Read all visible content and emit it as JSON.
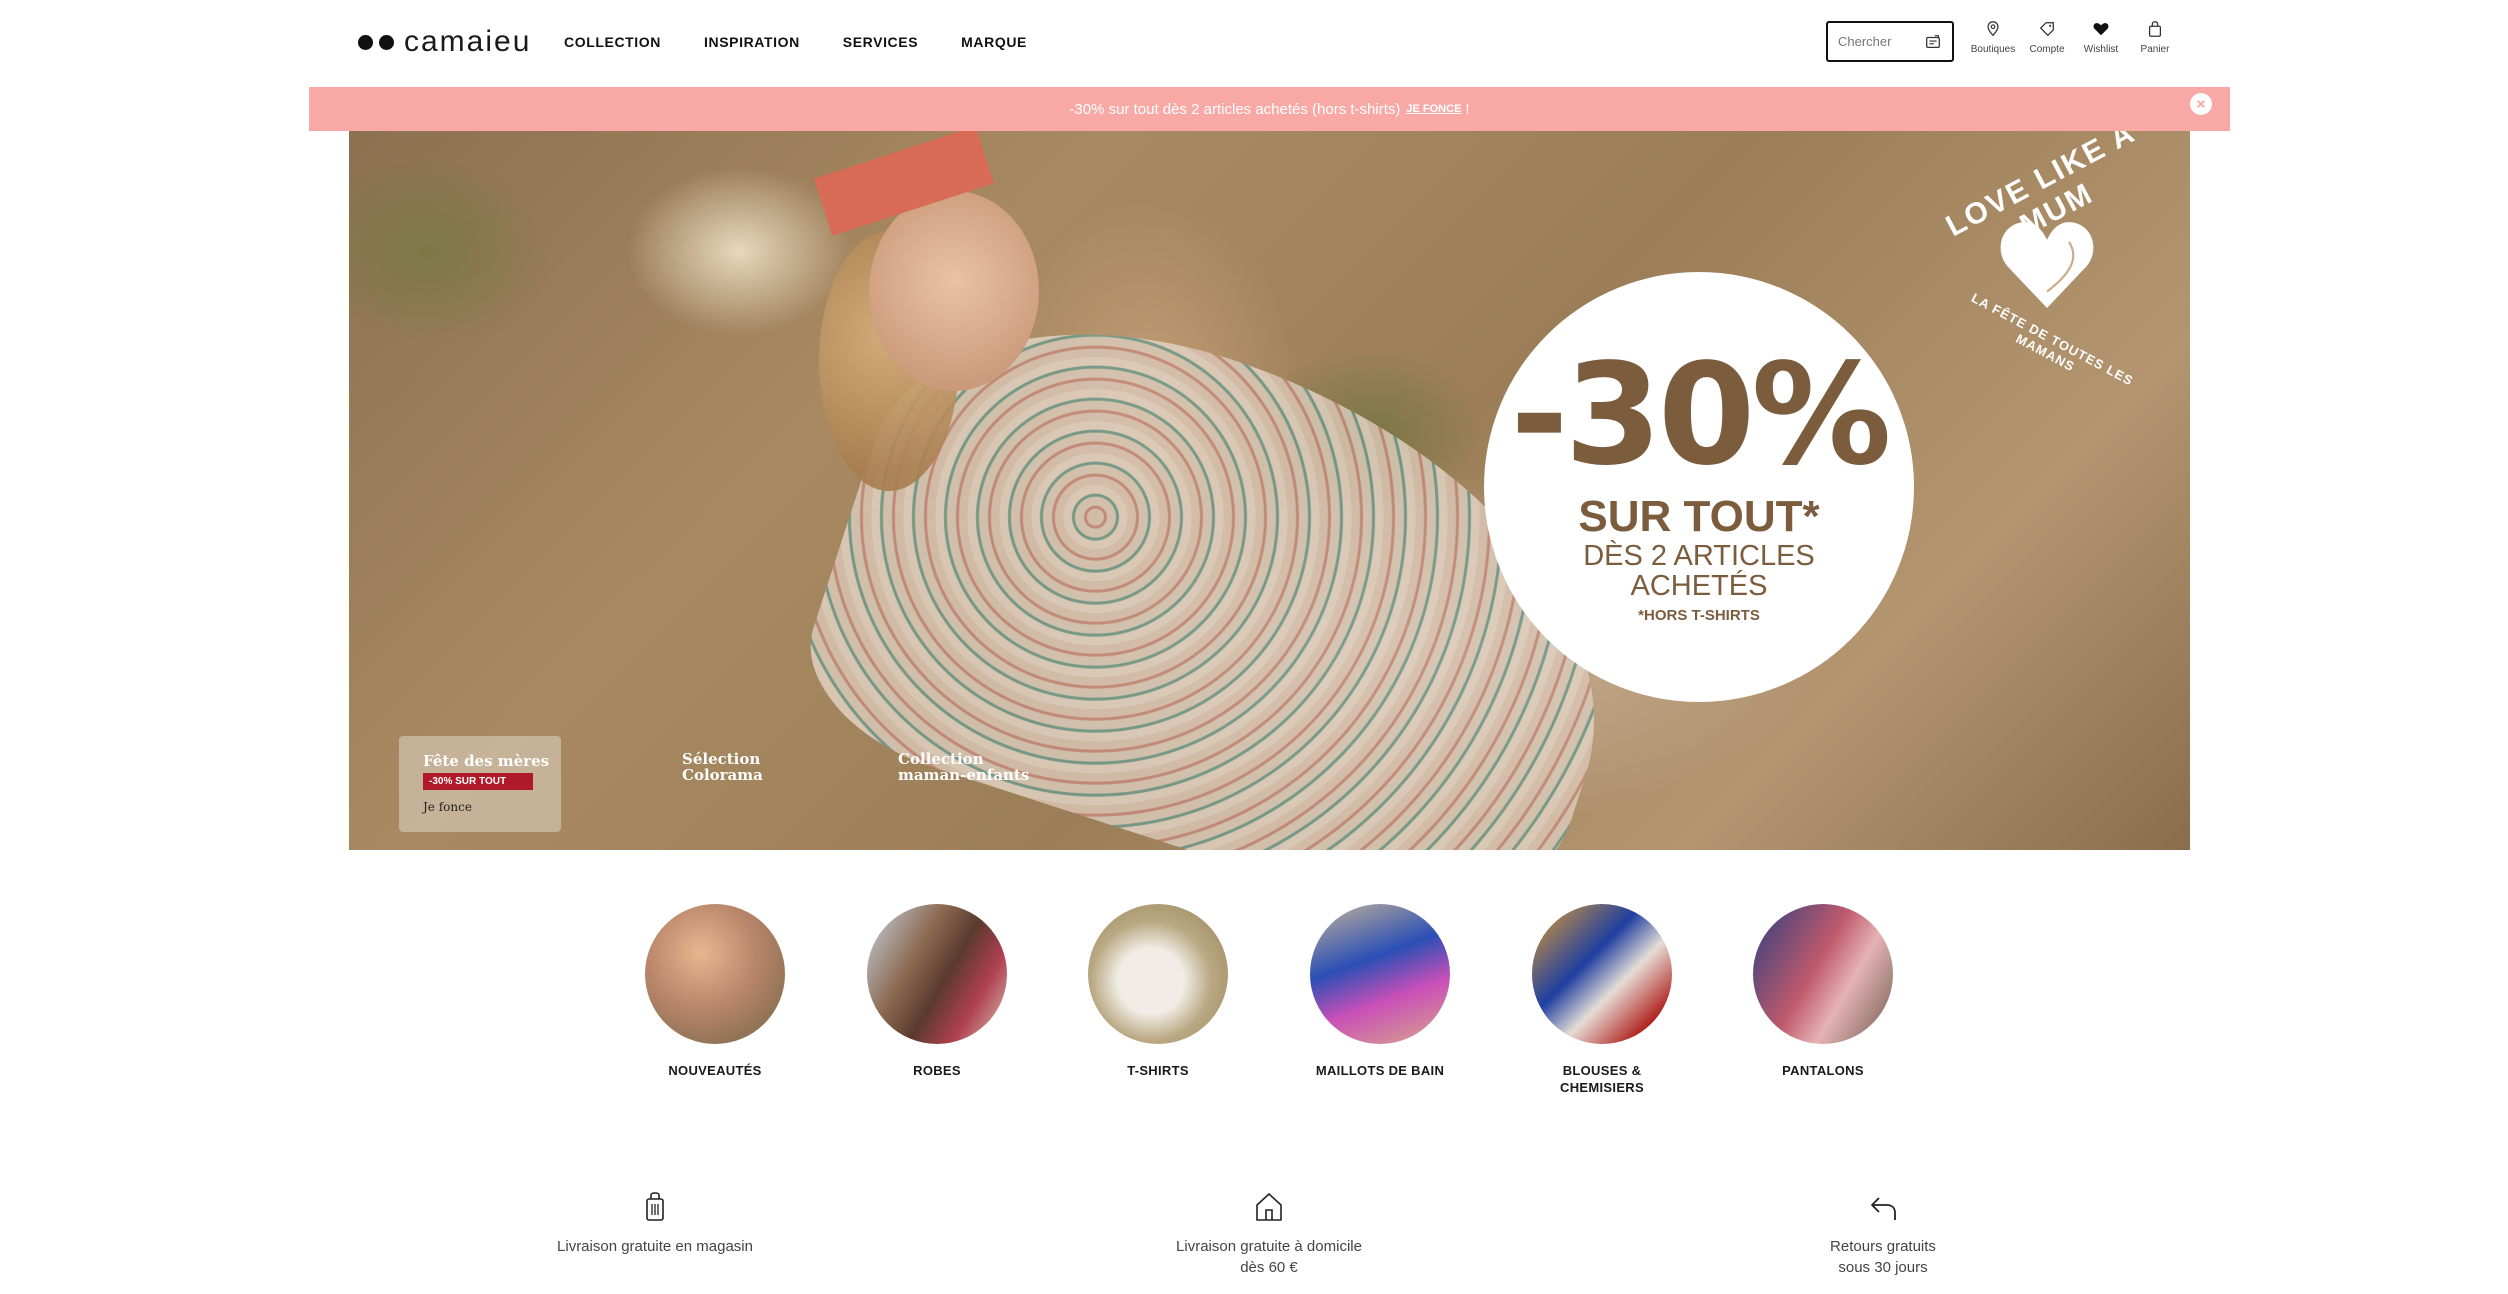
{
  "header": {
    "logo": "camaieu",
    "nav": [
      "COLLECTION",
      "INSPIRATION",
      "SERVICES",
      "MARQUE"
    ],
    "search_placeholder": "Chercher",
    "icons": [
      {
        "name": "store-icon",
        "label": "Boutiques"
      },
      {
        "name": "account-icon",
        "label": "Compte"
      },
      {
        "name": "heart-icon",
        "label": "Wishlist"
      },
      {
        "name": "bag-icon",
        "label": "Panier"
      }
    ]
  },
  "promo": {
    "text": "-30% sur tout dès 2 articles achetés (hors t-shirts)",
    "link": "JE FONCE",
    "suffix": "!",
    "bg_color": "#f8a9a6"
  },
  "hero": {
    "offer_big": "-30%",
    "offer_mid": "SUR TOUT*",
    "offer_sub_1": "DÈS 2 ARTICLES",
    "offer_sub_2": "ACHETÉS",
    "offer_note": "*HORS T-SHIRTS",
    "badge_top": "LOVE LIKE A MUM",
    "badge_bottom": "LA FÊTE DE TOUTES LES MAMANS",
    "card": {
      "title": "Fête des mères",
      "tag": "-30% SUR TOUT",
      "cta": "Je fonce"
    },
    "links": [
      {
        "line1": "Sélection",
        "line2": "Colorama"
      },
      {
        "line1": "Collection",
        "line2": "maman-enfants"
      }
    ]
  },
  "categories": [
    {
      "label": "NOUVEAUTÉS"
    },
    {
      "label": "ROBES"
    },
    {
      "label": "T-SHIRTS"
    },
    {
      "label": "MAILLOTS DE BAIN"
    },
    {
      "label": "BLOUSES &",
      "label2": "CHEMISIERS"
    },
    {
      "label": "PANTALONS"
    }
  ],
  "services": [
    {
      "icon": "store-pickup-icon",
      "line1": "Livraison gratuite en magasin",
      "line2": ""
    },
    {
      "icon": "home-icon",
      "line1": "Livraison gratuite à domicile",
      "line2": "dès 60 €"
    },
    {
      "icon": "return-arrow-icon",
      "line1": "Retours gratuits",
      "line2": "sous 30 jours"
    }
  ]
}
